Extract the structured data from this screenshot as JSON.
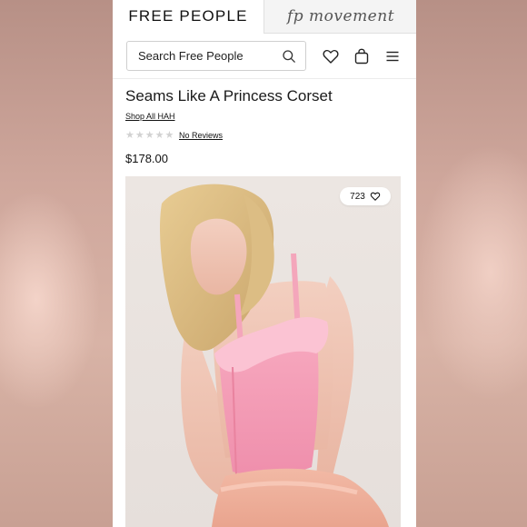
{
  "header": {
    "brand": "FREE PEOPLE",
    "movement_logo": "fp movement",
    "search_placeholder": "Search Free People",
    "icons": [
      "search-icon",
      "heart-icon",
      "bag-icon",
      "menu-icon"
    ]
  },
  "product": {
    "title": "Seams Like A Princess Corset",
    "shop_link": "Shop All HAH",
    "rating_stars": 0,
    "reviews_label": "No Reviews",
    "price": "$178.00",
    "like_count": "723"
  },
  "colors": {
    "accent_pink": "#f5a3b8",
    "text": "#111111",
    "star_empty": "#d2d2d2"
  }
}
